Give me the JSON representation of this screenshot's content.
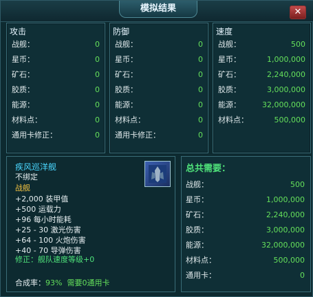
{
  "window": {
    "title": "模拟结果"
  },
  "attack": {
    "title": "攻击",
    "rows": [
      [
        "战舰：",
        "0"
      ],
      [
        "星币：",
        "0"
      ],
      [
        "矿石：",
        "0"
      ],
      [
        "胶质：",
        "0"
      ],
      [
        "能源：",
        "0"
      ],
      [
        "材料点：",
        "0"
      ],
      [
        "通用卡修正：",
        "0"
      ]
    ]
  },
  "defense": {
    "title": "防御",
    "rows": [
      [
        "战舰：",
        "0"
      ],
      [
        "星币：",
        "0"
      ],
      [
        "矿石：",
        "0"
      ],
      [
        "胶质：",
        "0"
      ],
      [
        "能源：",
        "0"
      ],
      [
        "材料点：",
        "0"
      ],
      [
        "通用卡修正：",
        "0"
      ]
    ]
  },
  "speed": {
    "title": "速度",
    "rows": [
      [
        "战舰：",
        "500"
      ],
      [
        "星币：",
        "1,000,000"
      ],
      [
        "矿石：",
        "2,240,000"
      ],
      [
        "胶质：",
        "3,000,000"
      ],
      [
        "能源：",
        "32,000,000"
      ],
      [
        "材料点：",
        "500,000"
      ]
    ]
  },
  "item": {
    "name": "疾风巡洋舰",
    "bind": "不绑定",
    "type": "战舰",
    "stats": [
      "+2,000  装甲值",
      "+500  运载力",
      "+96  每小时能耗",
      "+25 - 30  激光伤害",
      "+64 - 100  火炮伤害",
      "+40 - 70  导弹伤害"
    ],
    "modifier": "修正：舰队速度等级+0",
    "rate_label": "合成率：",
    "rate_value": "93%",
    "cards_needed": "需要0通用卡"
  },
  "total": {
    "title": "总共需要：",
    "rows": [
      [
        "战舰：",
        "500"
      ],
      [
        "星币：",
        "1,000,000"
      ],
      [
        "矿石：",
        "2,240,000"
      ],
      [
        "胶质：",
        "3,000,000"
      ],
      [
        "能源：",
        "32,000,000"
      ],
      [
        "材料点：",
        "500,000"
      ],
      [
        "通用卡：",
        "0"
      ]
    ]
  }
}
